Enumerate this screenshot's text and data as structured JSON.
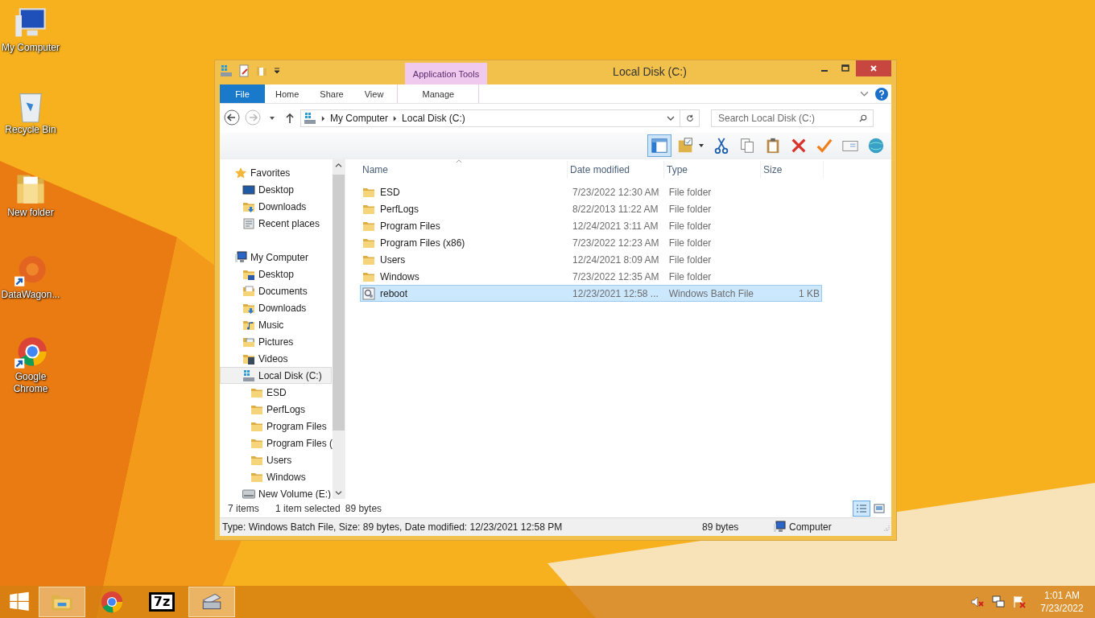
{
  "desktop_icons": [
    {
      "label": "My Computer",
      "kind": "computer",
      "shortcut": false
    },
    {
      "label": "Recycle Bin",
      "kind": "recycle",
      "shortcut": false
    },
    {
      "label": "New folder",
      "kind": "folder",
      "shortcut": false
    },
    {
      "label": "DataWagon...",
      "kind": "app",
      "shortcut": true
    },
    {
      "label": "Google Chrome",
      "kind": "chrome",
      "shortcut": true
    }
  ],
  "window": {
    "title": "Local Disk (C:)",
    "context_group": "Application Tools",
    "ribbon_tabs": [
      {
        "label": "File",
        "kind": "file",
        "selected": false
      },
      {
        "label": "Home",
        "kind": "tab",
        "selected": false
      },
      {
        "label": "Share",
        "kind": "tab",
        "selected": false
      },
      {
        "label": "View",
        "kind": "tab",
        "selected": false
      },
      {
        "label": "Manage",
        "kind": "context",
        "selected": false
      }
    ],
    "address": {
      "crumbs": [
        "My Computer",
        "Local Disk (C:)"
      ]
    },
    "search": {
      "placeholder": "Search Local Disk (C:)"
    },
    "preview_pane": {
      "on": true
    },
    "toolbar": [
      {
        "kind": "folder-options"
      },
      {
        "kind": "cut"
      },
      {
        "kind": "copy"
      },
      {
        "kind": "paste"
      },
      {
        "kind": "delete"
      },
      {
        "kind": "check"
      },
      {
        "kind": "card"
      },
      {
        "kind": "globe"
      }
    ],
    "nav_tree": [
      {
        "label": "Favorites",
        "kind": "star",
        "selected": false,
        "children": [
          {
            "label": "Desktop",
            "kind": "desktop",
            "selected": false
          },
          {
            "label": "Downloads",
            "kind": "downloads",
            "selected": false
          },
          {
            "label": "Recent places",
            "kind": "recent",
            "selected": false
          }
        ]
      },
      {
        "label": "My Computer",
        "kind": "computer",
        "selected": false,
        "children": [
          {
            "label": "Desktop",
            "kind": "desktop-folder",
            "selected": false
          },
          {
            "label": "Documents",
            "kind": "documents",
            "selected": false
          },
          {
            "label": "Downloads",
            "kind": "downloads",
            "selected": false
          },
          {
            "label": "Music",
            "kind": "music",
            "selected": false
          },
          {
            "label": "Pictures",
            "kind": "pictures",
            "selected": false
          },
          {
            "label": "Videos",
            "kind": "videos",
            "selected": false
          },
          {
            "label": "Local Disk (C:)",
            "kind": "drive",
            "selected": true,
            "children": [
              {
                "label": "ESD",
                "kind": "folder",
                "selected": false
              },
              {
                "label": "PerfLogs",
                "kind": "folder",
                "selected": false
              },
              {
                "label": "Program Files",
                "kind": "folder",
                "selected": false
              },
              {
                "label": "Program Files (",
                "kind": "folder",
                "selected": false
              },
              {
                "label": "Users",
                "kind": "folder",
                "selected": false
              },
              {
                "label": "Windows",
                "kind": "folder",
                "selected": false
              }
            ]
          },
          {
            "label": "New Volume (E:)",
            "kind": "volume",
            "selected": false
          }
        ]
      }
    ],
    "columns": [
      "Name",
      "Date modified",
      "Type",
      "Size"
    ],
    "rows": [
      {
        "name": "ESD",
        "date": "7/23/2022 12:30 AM",
        "type": "File folder",
        "kind": "folder",
        "selected": false
      },
      {
        "name": "PerfLogs",
        "date": "8/22/2013 11:22 AM",
        "type": "File folder",
        "kind": "folder",
        "selected": false
      },
      {
        "name": "Program Files",
        "date": "12/24/2021 3:11 AM",
        "type": "File folder",
        "kind": "folder",
        "selected": false
      },
      {
        "name": "Program Files (x86)",
        "date": "7/23/2022 12:23 AM",
        "type": "File folder",
        "kind": "folder",
        "selected": false
      },
      {
        "name": "Users",
        "date": "12/24/2021 8:09 AM",
        "type": "File folder",
        "kind": "folder",
        "selected": false
      },
      {
        "name": "Windows",
        "date": "7/23/2022 12:35 AM",
        "type": "File folder",
        "kind": "folder",
        "selected": false
      },
      {
        "name": "reboot",
        "date": "12/23/2021 12:58 ...",
        "type": "Windows Batch File",
        "size": "1 KB",
        "kind": "batch",
        "selected": true
      }
    ],
    "status": {
      "count": "7 items",
      "selection": "1 item selected",
      "selection_size": "89 bytes"
    },
    "views": [
      {
        "kind": "details",
        "selected": true
      },
      {
        "kind": "tiles",
        "selected": false
      }
    ],
    "details_bar": {
      "text": "Type: Windows Batch File, Size: 89 bytes, Date modified: 12/23/2021 12:58 PM",
      "size": "89 bytes",
      "location": "Computer"
    }
  },
  "taskbar": {
    "apps": [
      {
        "kind": "explorer",
        "selected": true
      },
      {
        "kind": "chrome",
        "selected": false
      },
      {
        "kind": "sevenzip",
        "label": "7z",
        "selected": false
      },
      {
        "kind": "scanner",
        "selected": true
      }
    ],
    "clock": {
      "time": "1:01 AM",
      "date": "7/23/2022"
    }
  }
}
